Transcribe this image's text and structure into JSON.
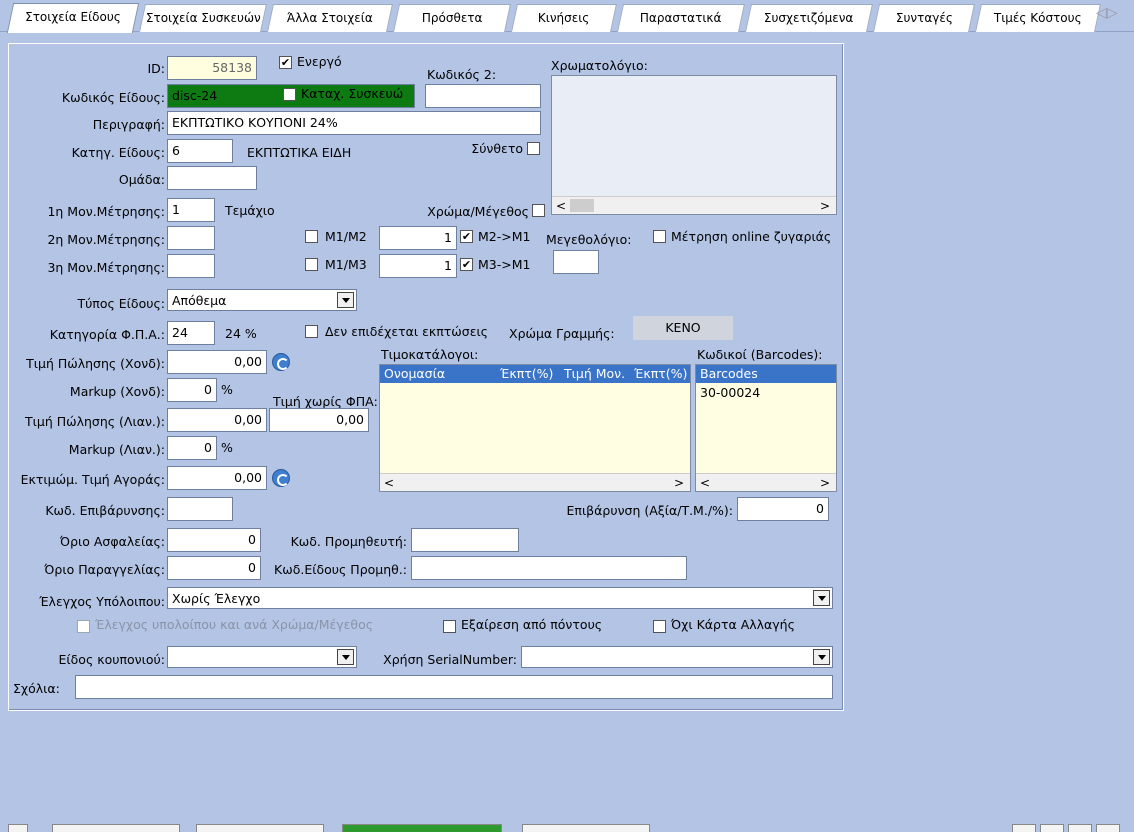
{
  "tabs": [
    "Στοιχεία Είδους",
    "Στοιχεία Συσκευών",
    "Άλλα Στοιχεία",
    "Πρόσθετα",
    "Κινήσεις",
    "Παραστατικά",
    "Συσχετιζόμενα",
    "Συνταγές",
    "Τιμές Κόστους"
  ],
  "form": {
    "id_label": "ID:",
    "id_value": "58138",
    "active_label": "Ενεργό",
    "code_label": "Κωδικός Είδους:",
    "code_value": "disc-24",
    "device_label": "Καταχ. Συσκευώ",
    "code2_label": "Κωδικός 2:",
    "code2_value": "",
    "desc_label": "Περιγραφή:",
    "desc_value": "ΕΚΠΤΩΤΙΚΟ ΚΟΥΠΟΝΙ 24%",
    "cat_label": "Κατηγ. Είδους:",
    "cat_value": "6",
    "cat_name": "ΕΚΠΤΩΤΙΚΑ ΕΙΔΗ",
    "composite_label": "Σύνθετο",
    "group_label": "Ομάδα:",
    "group_value": "",
    "unit1_label": "1η Μον.Μέτρησης:",
    "unit1_value": "1",
    "unit1_name": "Τεμάχιο",
    "unit2_label": "2η Μον.Μέτρησης:",
    "unit3_label": "3η Μον.Μέτρησης:",
    "color_size_label": "Χρώμα/Μέγεθος",
    "m1m2_label": "M1/M2",
    "m1m2_value": "1",
    "m2m1_label": "M2->M1",
    "m1m3_label": "M1/M3",
    "m1m3_value": "1",
    "m3m1_label": "M3->M1",
    "colors_label": "Χρωματολόγιο:",
    "sizes_label": "Μεγεθολόγιο:",
    "online_scale_label": "Μέτρηση online ζυγαριάς",
    "type_label": "Τύπος Είδους:",
    "type_value": "Απόθεμα",
    "vat_label": "Κατηγορία Φ.Π.Α.:",
    "vat_value": "24",
    "vat_pct": "24 %",
    "nodiscount_label": "Δεν επιδέχεται εκπτώσεις",
    "rowcolor_label": "Χρώμα Γραμμής:",
    "rowcolor_value": "ΚΕΝΟ",
    "price_wh_label": "Τιμή Πώλησης (Χονδ):",
    "price_wh_value": "0,00",
    "markup_wh_label": "Markup (Χονδ):",
    "markup_wh_value": "0",
    "pct": "%",
    "novat_label": "Τιμή χωρίς ΦΠΑ:",
    "novat_value": "0,00",
    "price_rt_label": "Τιμή Πώλησης (Λιαν.):",
    "price_rt_value": "0,00",
    "markup_rt_label": "Markup (Λιαν.):",
    "markup_rt_value": "0",
    "est_cost_label": "Εκτιμώμ. Τιμή Αγοράς:",
    "est_cost_value": "0,00",
    "charge_code_label": "Κωδ. Επιβάρυνσης:",
    "charge_label": "Επιβάρυνση (Αξία/Τ.Μ./%):",
    "charge_value": "0",
    "safety_label": "Όριο Ασφαλείας:",
    "safety_value": "0",
    "supplier_label": "Κωδ. Προμηθευτή:",
    "reorder_label": "Όριο Παραγγελίας:",
    "reorder_value": "0",
    "supplier_item_label": "Κωδ.Είδους Προμηθ.:",
    "balance_label": "Έλεγχος Υπόλοιπου:",
    "balance_value": "Χωρίς Έλεγχο",
    "balance_color_label": "Έλεγχος υπολοίπου και ανά Χρώμα/Μέγεθος",
    "points_label": "Εξαίρεση από πόντους",
    "nochange_label": "Όχι Κάρτα Αλλαγής",
    "coupon_label": "Είδος κουπονιού:",
    "serial_label": "Χρήση SerialNumber:",
    "notes_label": "Σχόλια:"
  },
  "pricelists": {
    "title": "Τιμοκατάλογοι:",
    "columns": [
      "Ονομασία",
      "Έκπτ(%)",
      "Τιμή Μον.",
      "Έκπτ(%)"
    ]
  },
  "barcodes": {
    "title": "Κωδικοί (Barcodes):",
    "column": "Barcodes",
    "rows": [
      "30-00024"
    ]
  }
}
